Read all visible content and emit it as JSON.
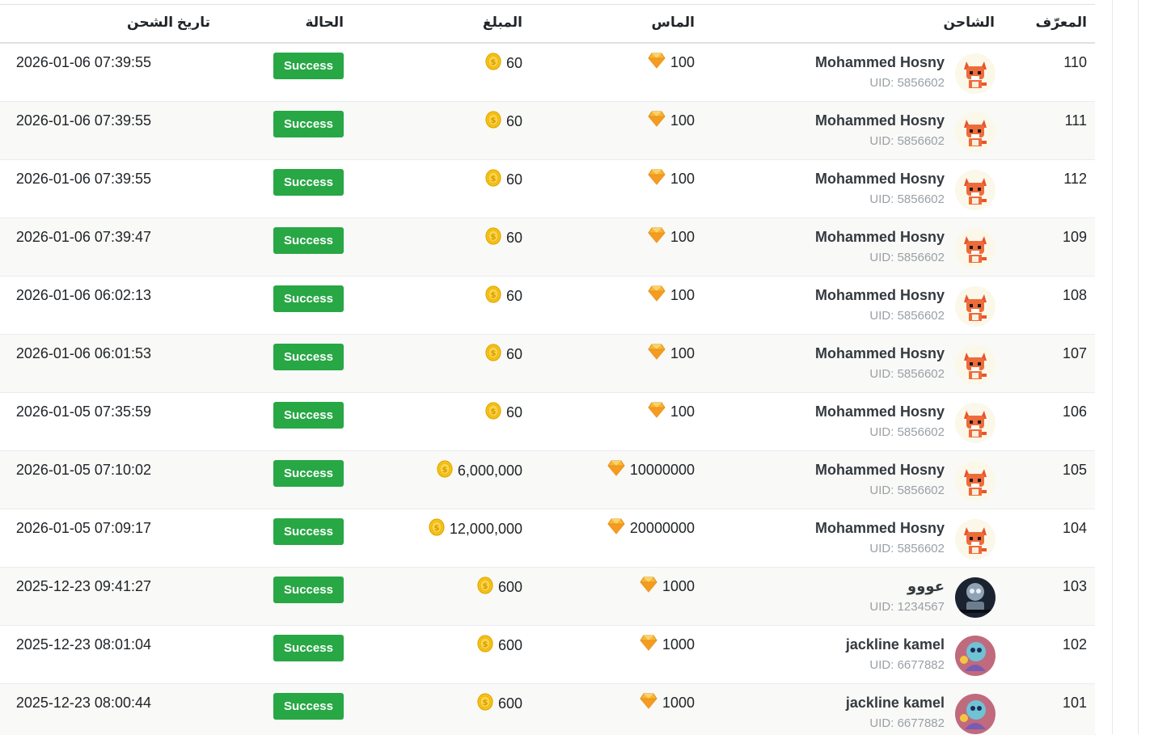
{
  "headers": {
    "id": "المعرّف",
    "charger": "الشاحن",
    "diamonds": "الماس",
    "amount": "المبلغ",
    "status": "الحالة",
    "date": "تاريخ الشحن"
  },
  "colors": {
    "success": "#28a745",
    "diamond": "#f5a623",
    "coin": "#f2c200"
  },
  "rows": [
    {
      "id": "110",
      "name": "Mohammed Hosny",
      "uid": "UID: 5856602",
      "avatar": "fox-avatar-icon",
      "diamonds": "100",
      "amount": "60",
      "status": "Success",
      "date": "2026-01-06 07:39:55"
    },
    {
      "id": "111",
      "name": "Mohammed Hosny",
      "uid": "UID: 5856602",
      "avatar": "fox-avatar-icon",
      "diamonds": "100",
      "amount": "60",
      "status": "Success",
      "date": "2026-01-06 07:39:55"
    },
    {
      "id": "112",
      "name": "Mohammed Hosny",
      "uid": "UID: 5856602",
      "avatar": "fox-avatar-icon",
      "diamonds": "100",
      "amount": "60",
      "status": "Success",
      "date": "2026-01-06 07:39:55"
    },
    {
      "id": "109",
      "name": "Mohammed Hosny",
      "uid": "UID: 5856602",
      "avatar": "fox-avatar-icon",
      "diamonds": "100",
      "amount": "60",
      "status": "Success",
      "date": "2026-01-06 07:39:47"
    },
    {
      "id": "108",
      "name": "Mohammed Hosny",
      "uid": "UID: 5856602",
      "avatar": "fox-avatar-icon",
      "diamonds": "100",
      "amount": "60",
      "status": "Success",
      "date": "2026-01-06 06:02:13"
    },
    {
      "id": "107",
      "name": "Mohammed Hosny",
      "uid": "UID: 5856602",
      "avatar": "fox-avatar-icon",
      "diamonds": "100",
      "amount": "60",
      "status": "Success",
      "date": "2026-01-06 06:01:53"
    },
    {
      "id": "106",
      "name": "Mohammed Hosny",
      "uid": "UID: 5856602",
      "avatar": "fox-avatar-icon",
      "diamonds": "100",
      "amount": "60",
      "status": "Success",
      "date": "2026-01-05 07:35:59"
    },
    {
      "id": "105",
      "name": "Mohammed Hosny",
      "uid": "UID: 5856602",
      "avatar": "fox-avatar-icon",
      "diamonds": "10000000",
      "amount": "6,000,000",
      "status": "Success",
      "date": "2026-01-05 07:10:02"
    },
    {
      "id": "104",
      "name": "Mohammed Hosny",
      "uid": "UID: 5856602",
      "avatar": "fox-avatar-icon",
      "diamonds": "20000000",
      "amount": "12,000,000",
      "status": "Success",
      "date": "2026-01-05 07:09:17"
    },
    {
      "id": "103",
      "name": "عووو",
      "uid": "UID: 1234567",
      "avatar": "robot-avatar-icon",
      "diamonds": "1000",
      "amount": "600",
      "status": "Success",
      "date": "2025-12-23 09:41:27"
    },
    {
      "id": "102",
      "name": "jackline kamel",
      "uid": "UID: 6677882",
      "avatar": "creature-avatar-icon",
      "diamonds": "1000",
      "amount": "600",
      "status": "Success",
      "date": "2025-12-23 08:01:04"
    },
    {
      "id": "101",
      "name": "jackline kamel",
      "uid": "UID: 6677882",
      "avatar": "creature-avatar-icon",
      "diamonds": "1000",
      "amount": "600",
      "status": "Success",
      "date": "2025-12-23 08:00:44"
    }
  ]
}
